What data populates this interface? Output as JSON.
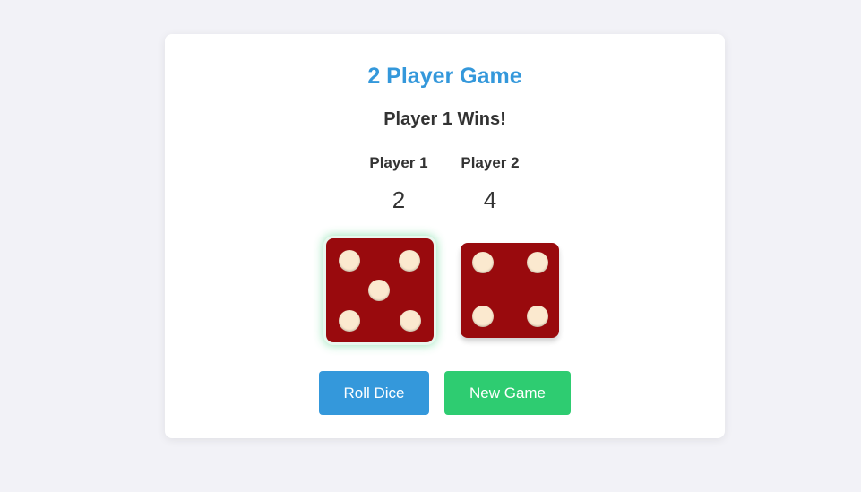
{
  "game": {
    "title": "2 Player Game",
    "status": "Player 1 Wins!"
  },
  "players": [
    {
      "label": "Player 1",
      "score": "2",
      "die_value": 5,
      "winner": true
    },
    {
      "label": "Player 2",
      "score": "4",
      "die_value": 4,
      "winner": false
    }
  ],
  "buttons": {
    "roll_label": "Roll Dice",
    "new_game_label": "New Game"
  },
  "colors": {
    "title": "#3498db",
    "roll_button": "#3498db",
    "new_game_button": "#2ecc71",
    "die_face": "#990a0d",
    "die_pip": "#fbe9cf",
    "winner_glow": "#2ecc71"
  }
}
